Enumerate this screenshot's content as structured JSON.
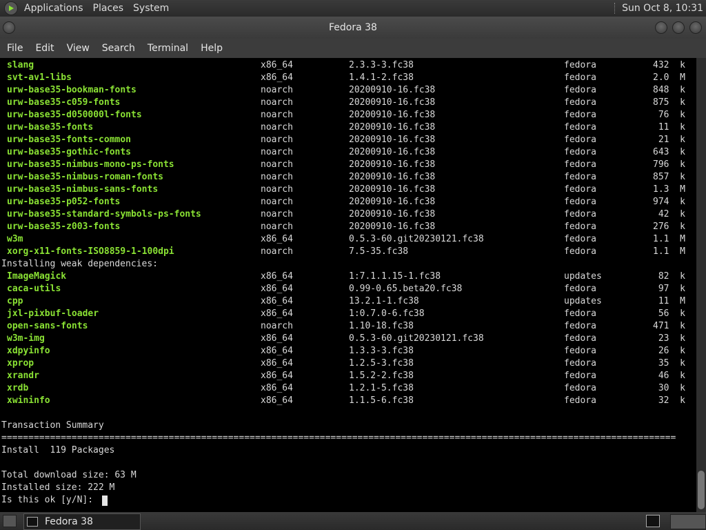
{
  "top_panel": {
    "menus": [
      "Applications",
      "Places",
      "System"
    ],
    "clock": "Sun Oct  8, 10:31"
  },
  "window": {
    "title": "Fedora 38"
  },
  "menubar": {
    "items": [
      "File",
      "Edit",
      "View",
      "Search",
      "Terminal",
      "Help"
    ]
  },
  "terminal": {
    "packages_top": [
      {
        "name": "slang",
        "arch": "x86_64",
        "version": "2.3.3-3.fc38",
        "repo": "fedora",
        "size": "432  k"
      },
      {
        "name": "svt-av1-libs",
        "arch": "x86_64",
        "version": "1.4.1-2.fc38",
        "repo": "fedora",
        "size": "2.0  M"
      },
      {
        "name": "urw-base35-bookman-fonts",
        "arch": "noarch",
        "version": "20200910-16.fc38",
        "repo": "fedora",
        "size": "848  k"
      },
      {
        "name": "urw-base35-c059-fonts",
        "arch": "noarch",
        "version": "20200910-16.fc38",
        "repo": "fedora",
        "size": "875  k"
      },
      {
        "name": "urw-base35-d050000l-fonts",
        "arch": "noarch",
        "version": "20200910-16.fc38",
        "repo": "fedora",
        "size": "76  k"
      },
      {
        "name": "urw-base35-fonts",
        "arch": "noarch",
        "version": "20200910-16.fc38",
        "repo": "fedora",
        "size": "11  k"
      },
      {
        "name": "urw-base35-fonts-common",
        "arch": "noarch",
        "version": "20200910-16.fc38",
        "repo": "fedora",
        "size": "21  k"
      },
      {
        "name": "urw-base35-gothic-fonts",
        "arch": "noarch",
        "version": "20200910-16.fc38",
        "repo": "fedora",
        "size": "643  k"
      },
      {
        "name": "urw-base35-nimbus-mono-ps-fonts",
        "arch": "noarch",
        "version": "20200910-16.fc38",
        "repo": "fedora",
        "size": "796  k"
      },
      {
        "name": "urw-base35-nimbus-roman-fonts",
        "arch": "noarch",
        "version": "20200910-16.fc38",
        "repo": "fedora",
        "size": "857  k"
      },
      {
        "name": "urw-base35-nimbus-sans-fonts",
        "arch": "noarch",
        "version": "20200910-16.fc38",
        "repo": "fedora",
        "size": "1.3  M"
      },
      {
        "name": "urw-base35-p052-fonts",
        "arch": "noarch",
        "version": "20200910-16.fc38",
        "repo": "fedora",
        "size": "974  k"
      },
      {
        "name": "urw-base35-standard-symbols-ps-fonts",
        "arch": "noarch",
        "version": "20200910-16.fc38",
        "repo": "fedora",
        "size": "42  k"
      },
      {
        "name": "urw-base35-z003-fonts",
        "arch": "noarch",
        "version": "20200910-16.fc38",
        "repo": "fedora",
        "size": "276  k"
      },
      {
        "name": "w3m",
        "arch": "x86_64",
        "version": "0.5.3-60.git20230121.fc38",
        "repo": "fedora",
        "size": "1.1  M"
      },
      {
        "name": "xorg-x11-fonts-ISO8859-1-100dpi",
        "arch": "noarch",
        "version": "7.5-35.fc38",
        "repo": "fedora",
        "size": "1.1  M"
      }
    ],
    "weak_header": "Installing weak dependencies:",
    "packages_weak": [
      {
        "name": "ImageMagick",
        "arch": "x86_64",
        "version": "1:7.1.1.15-1.fc38",
        "repo": "updates",
        "size": "82  k"
      },
      {
        "name": "caca-utils",
        "arch": "x86_64",
        "version": "0.99-0.65.beta20.fc38",
        "repo": "fedora",
        "size": "97  k"
      },
      {
        "name": "cpp",
        "arch": "x86_64",
        "version": "13.2.1-1.fc38",
        "repo": "updates",
        "size": "11  M"
      },
      {
        "name": "jxl-pixbuf-loader",
        "arch": "x86_64",
        "version": "1:0.7.0-6.fc38",
        "repo": "fedora",
        "size": "56  k"
      },
      {
        "name": "open-sans-fonts",
        "arch": "noarch",
        "version": "1.10-18.fc38",
        "repo": "fedora",
        "size": "471  k"
      },
      {
        "name": "w3m-img",
        "arch": "x86_64",
        "version": "0.5.3-60.git20230121.fc38",
        "repo": "fedora",
        "size": "23  k"
      },
      {
        "name": "xdpyinfo",
        "arch": "x86_64",
        "version": "1.3.3-3.fc38",
        "repo": "fedora",
        "size": "26  k"
      },
      {
        "name": "xprop",
        "arch": "x86_64",
        "version": "1.2.5-3.fc38",
        "repo": "fedora",
        "size": "35  k"
      },
      {
        "name": "xrandr",
        "arch": "x86_64",
        "version": "1.5.2-2.fc38",
        "repo": "fedora",
        "size": "46  k"
      },
      {
        "name": "xrdb",
        "arch": "x86_64",
        "version": "1.2.1-5.fc38",
        "repo": "fedora",
        "size": "30  k"
      },
      {
        "name": "xwininfo",
        "arch": "x86_64",
        "version": "1.1.5-6.fc38",
        "repo": "fedora",
        "size": "32  k"
      }
    ],
    "summary_header": "Transaction Summary",
    "rule": "=============================================================================================================================",
    "install_line": "Install  119 Packages",
    "download_size": "Total download size: 63 M",
    "installed_size": "Installed size: 222 M",
    "prompt": "Is this ok [y/N]: "
  },
  "bottom_panel": {
    "task_label": "Fedora 38"
  },
  "colors": {
    "package_name": "#8ae234",
    "terminal_bg": "#000000",
    "terminal_fg": "#d9d9d9"
  }
}
